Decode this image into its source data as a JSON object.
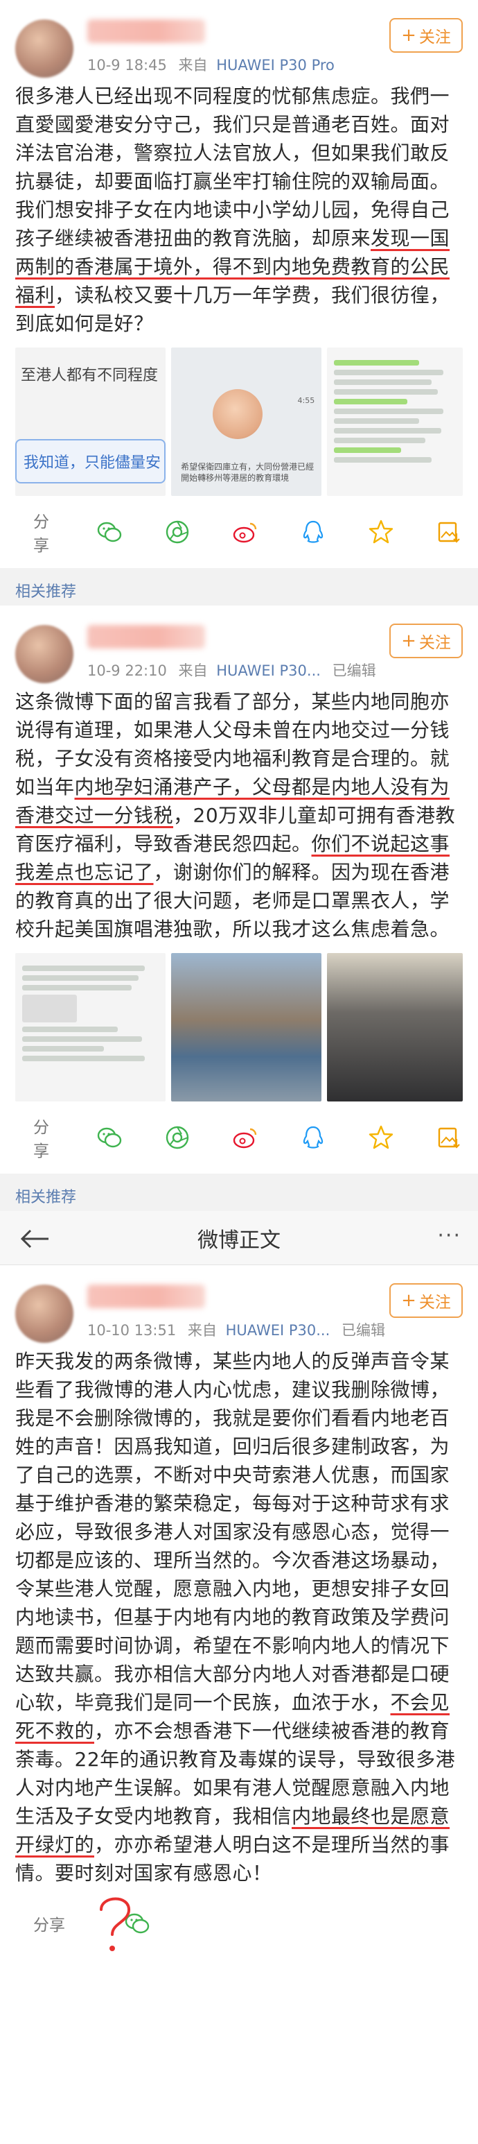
{
  "posts": [
    {
      "meta": {
        "time": "10-9 18:45",
        "source_label": "来自",
        "device": "HUAWEI P30 Pro",
        "edited": ""
      },
      "follow_label": "关注",
      "text_a": "很多港人已经出现不同程度的忧郁焦虑症。我們一直愛國愛港安分守己，我们只是普通老百姓。面对洋法官治港，警察拉人法官放人，但如果我们敢反抗暴徒，却要面临打赢坐牢打输住院的双输局面。我们想安排子女在内地读中小学幼儿园，免得自己孩子继续被香港扭曲的教育洗脑，却原来",
      "text_b": "发现一国两制的香港属于境外，得不到内地免费教育的公民福利",
      "text_c": "，读私校又要十几万一年学费，我们很彷徨，到底如何是好？",
      "img1_top": "至港人都有不同程度",
      "img1_banner": "我知道，只能儘量安",
      "img2_time": "4:55",
      "img2_caption": "希望保衛四庫立有，大同份營港已經開始轉移州等港居的教育環境",
      "share_label": "分享"
    },
    {
      "meta": {
        "time": "10-9 22:10",
        "source_label": "来自",
        "device": "HUAWEI P30...",
        "edited": "已编辑"
      },
      "follow_label": "关注",
      "text_a": "这条微博下面的留言我看了部分，某些内地同胞亦说得有道理，如果港人父母未曾在内地交过一分钱税，子女没有资格接受内地福利教育是合理的。就如当年",
      "text_b": "内地孕妇涌港产子，父母都是内地人没有为香港交过一分钱税",
      "text_c": "，20万双非儿童却可拥有香港教育医疗福利，导致香港民怨四起。",
      "text_d": "你们不说起这事我差点也忘记了",
      "text_e": "，谢谢你们的解释。因为现在香港的教育真的出了很大问题，老师是口罩黑衣人，学校升起美国旗唱港独歌，所以我才这么焦虑着急。",
      "share_label": "分享"
    },
    {
      "meta": {
        "time": "10-10 13:51",
        "source_label": "来自",
        "device": "HUAWEI P30...",
        "edited": "已编辑"
      },
      "follow_label": "关注",
      "text_a": "昨天我发的两条微博，某些内地人的反弹声音令某些看了我微博的港人内心忧虑，建议我删除微博，我是不会删除微博的，我就是要你们看看内地老百姓的声音！因爲我知道，回归后很多建制政客，为了自己的选票，不断对中央苛索港人优惠，而国家基于维护香港的繁荣稳定，每每对于这种苛求有求必应，导致很多港人对国家没有感恩心态，觉得一切都是应该的、理所当然的。今次香港这场暴动，令某些港人觉醒，愿意融入内地，更想安排子女回内地读书，但基于内地有内地的教育政策及学费问题而需要时间协调，希望在不影响内地人的情况下达致共赢。我亦相信大部分内地人对香港都是口硬心软，毕竟我们是同一个民族，血浓于水，",
      "text_b": "不会见死不救的",
      "text_c": "，亦不会想香港下一代继续被香港的教育荼毒。22年的通识教育及毒媒的误导，导致很多港人对内地产生误解。如果有港人觉醒愿意融入内地生活及子女受内地教育，我相信",
      "text_d": "内地最终也是愿意开绿灯的",
      "text_e": "，亦亦希望港人明白这不是理所当然的事情。要时刻对国家有感恩心！",
      "share_label": "分享"
    }
  ],
  "related_label": "相关推荐",
  "nav": {
    "title": "微博正文",
    "more": "···"
  },
  "icons": [
    "wechat-icon",
    "moments-icon",
    "weibo-icon",
    "qq-icon",
    "star-icon",
    "save-image-icon"
  ],
  "colors": {
    "accent": "#ee8f2c",
    "link": "#5b7db0",
    "annotation": "#e8312f"
  }
}
